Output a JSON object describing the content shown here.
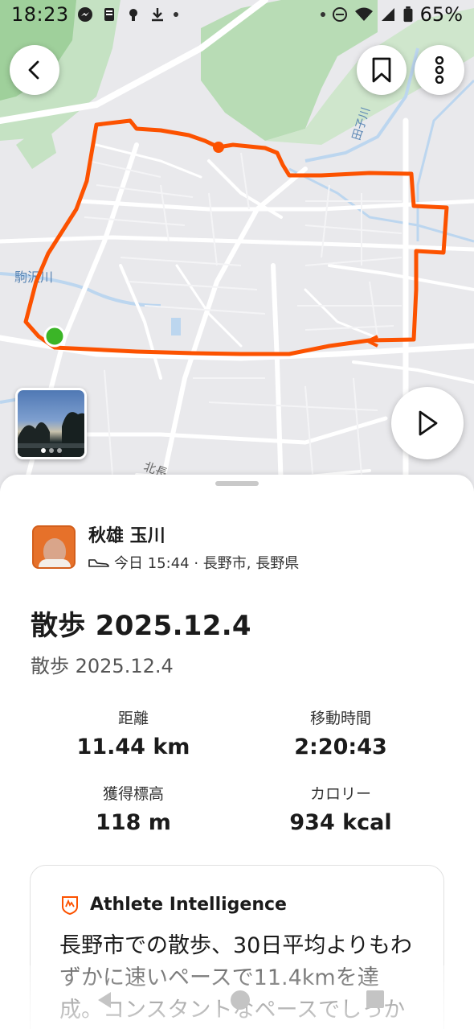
{
  "status_bar": {
    "time": "18:23",
    "battery": "65%"
  },
  "map": {
    "labels": [
      "駒沢川",
      "田子川",
      "北長"
    ],
    "route_color": "#fc5200",
    "start_color": "#3bb527",
    "photo_count": 3
  },
  "athlete": {
    "name": "秋雄 玉川",
    "meta": "今日 15:44 · 長野市, 長野県"
  },
  "activity": {
    "title": "散歩 2025.12.4",
    "subtitle": "散歩 2025.12.4"
  },
  "stats": {
    "distance": {
      "label": "距離",
      "value": "11.44 km"
    },
    "moving_time": {
      "label": "移動時間",
      "value": "2:20:43"
    },
    "elevation": {
      "label": "獲得標高",
      "value": "118 m"
    },
    "calories": {
      "label": "カロリー",
      "value": "934 kcal"
    }
  },
  "athlete_intelligence": {
    "title": "Athlete Intelligence",
    "body": "長野市での散歩、30日平均よりもわずかに速いペースで11.4kmを達成。コンスタントなペースでしっかり継続と"
  },
  "icons": {
    "back": "chevron-left-icon",
    "bookmark": "bookmark-icon",
    "more": "more-vertical-icon",
    "play": "play-icon"
  }
}
